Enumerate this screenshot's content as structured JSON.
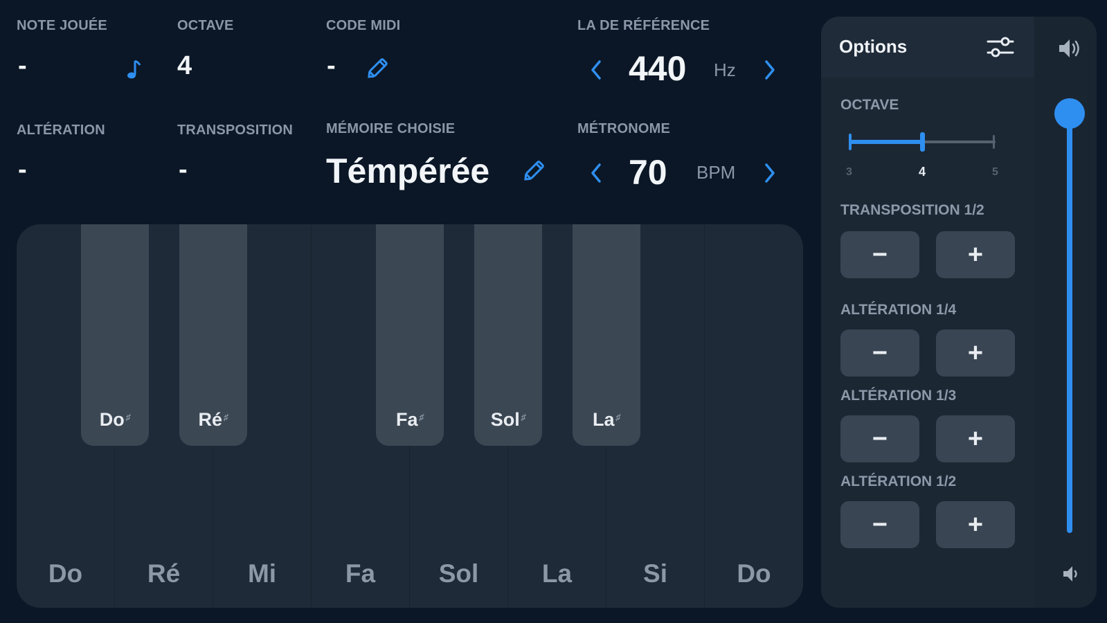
{
  "note": {
    "label": "NOTE JOUÉE",
    "value": "-"
  },
  "octave": {
    "label": "OCTAVE",
    "value": "4"
  },
  "midi": {
    "label": "CODE MIDI",
    "value": "-"
  },
  "reference": {
    "label": "LA DE RÉFÉRENCE",
    "value": "440",
    "unit": "Hz"
  },
  "alteration": {
    "label": "ALTÉRATION",
    "value": "-"
  },
  "transposition": {
    "label": "TRANSPOSITION",
    "value": "-"
  },
  "memory": {
    "label": "MÉMOIRE CHOISIE",
    "value": "Témpérée"
  },
  "metronome": {
    "label": "MÉTRONOME",
    "value": "70",
    "unit": "BPM"
  },
  "keyboard": {
    "white_keys": [
      "Do",
      "Ré",
      "Mi",
      "Fa",
      "Sol",
      "La",
      "Si",
      "Do"
    ],
    "black_keys": [
      "Do",
      "Ré",
      "Fa",
      "Sol",
      "La"
    ],
    "sharp_symbol": "♯"
  },
  "options": {
    "title": "Options",
    "octave_label": "OCTAVE",
    "octave_ticks": [
      "3",
      "4",
      "5"
    ],
    "octave_value": 4,
    "octave_slider_fraction": 0.5,
    "groups": [
      {
        "label": "TRANSPOSITION 1/2",
        "minus": "−",
        "plus": "+"
      },
      {
        "label": "ALTÉRATION 1/4",
        "minus": "−",
        "plus": "+"
      },
      {
        "label": "ALTÉRATION 1/3",
        "minus": "−",
        "plus": "+"
      },
      {
        "label": "ALTÉRATION 1/2",
        "minus": "−",
        "plus": "+"
      }
    ]
  },
  "volume": {
    "level_fraction": 1.0
  },
  "colors": {
    "accent": "#2f8ff0",
    "background": "#0b1726",
    "panel": "#1a2532",
    "key_black": "#3b4753"
  }
}
